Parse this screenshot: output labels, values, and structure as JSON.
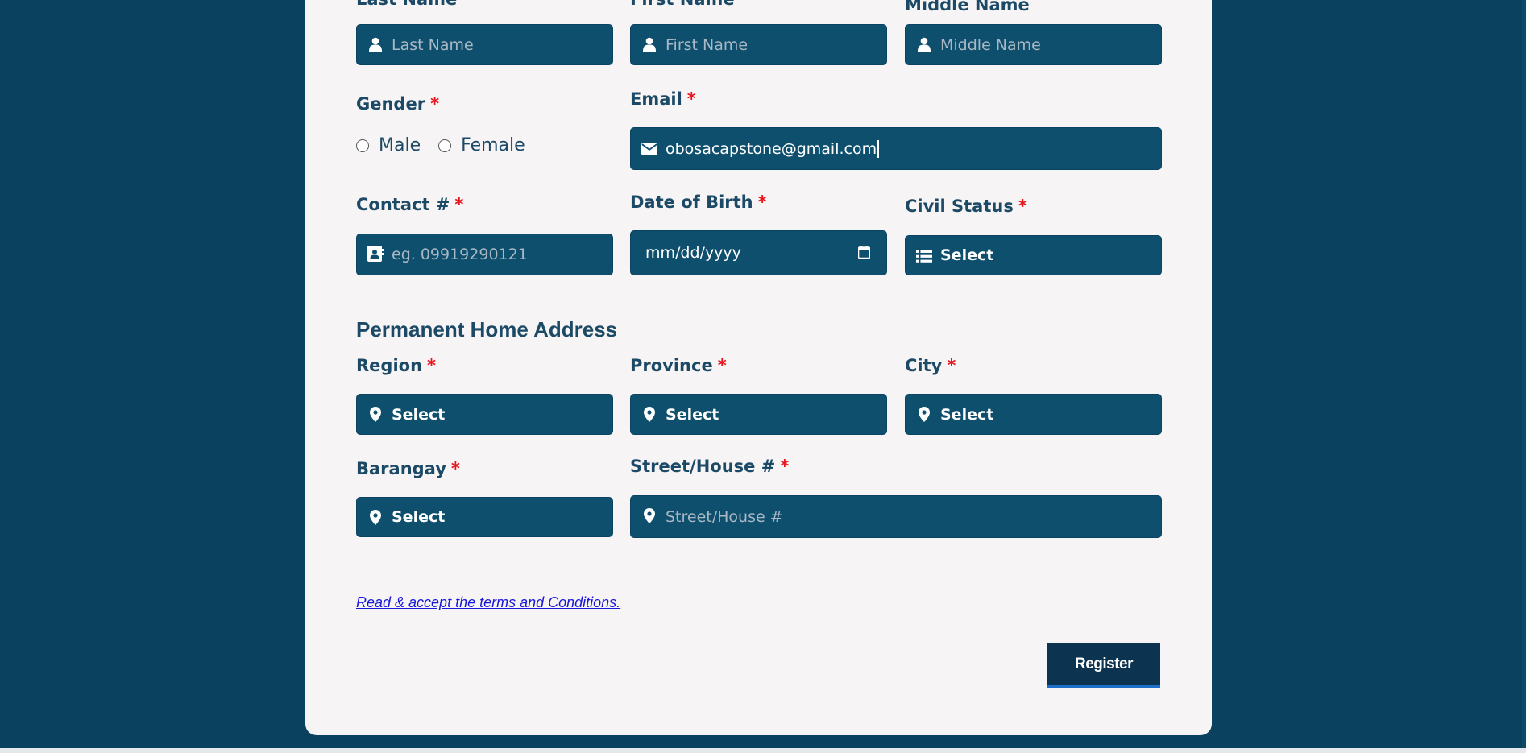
{
  "colors": {
    "page_background": "#0a415e",
    "card_background": "#f6f4f5",
    "field_background": "#0e4f6e",
    "label_text": "#1c4a66",
    "required_marker": "#e8141c",
    "link": "#1a18d8",
    "button": "#0c3350",
    "button_underline": "#1b6fc8"
  },
  "required_marker": "*",
  "name_row": {
    "last_name": {
      "label": "Last Name",
      "placeholder": "Last Name",
      "icon": "user-icon"
    },
    "first_name": {
      "label": "First Name",
      "placeholder": "First Name",
      "icon": "user-icon"
    },
    "middle_name": {
      "label": "Middle Name",
      "placeholder": "Middle Name",
      "icon": "user-icon"
    }
  },
  "gender": {
    "label": "Gender",
    "options": [
      "Male",
      "Female"
    ]
  },
  "email": {
    "label": "Email",
    "value": "obosacapstone@gmail.com",
    "icon": "envelope-icon"
  },
  "contact": {
    "label": "Contact #",
    "placeholder": "eg. 09919290121",
    "icon": "contact-card-icon"
  },
  "date_of_birth": {
    "label": "Date of Birth",
    "placeholder": "mm/dd/yyyy",
    "icon": "calendar-icon"
  },
  "civil_status": {
    "label": "Civil Status",
    "value": "Select",
    "icon": "list-icon"
  },
  "address_section": {
    "title": "Permanent Home Address",
    "region": {
      "label": "Region",
      "value": "Select",
      "icon": "map-marker-icon"
    },
    "province": {
      "label": "Province",
      "value": "Select",
      "icon": "map-marker-icon"
    },
    "city": {
      "label": "City",
      "value": "Select",
      "icon": "map-marker-icon"
    },
    "barangay": {
      "label": "Barangay",
      "value": "Select",
      "icon": "map-marker-icon"
    },
    "street": {
      "label": "Street/House #",
      "placeholder": "Street/House #",
      "icon": "map-marker-icon"
    }
  },
  "terms_link": "Read & accept the terms and Conditions.",
  "register_button": "Register"
}
